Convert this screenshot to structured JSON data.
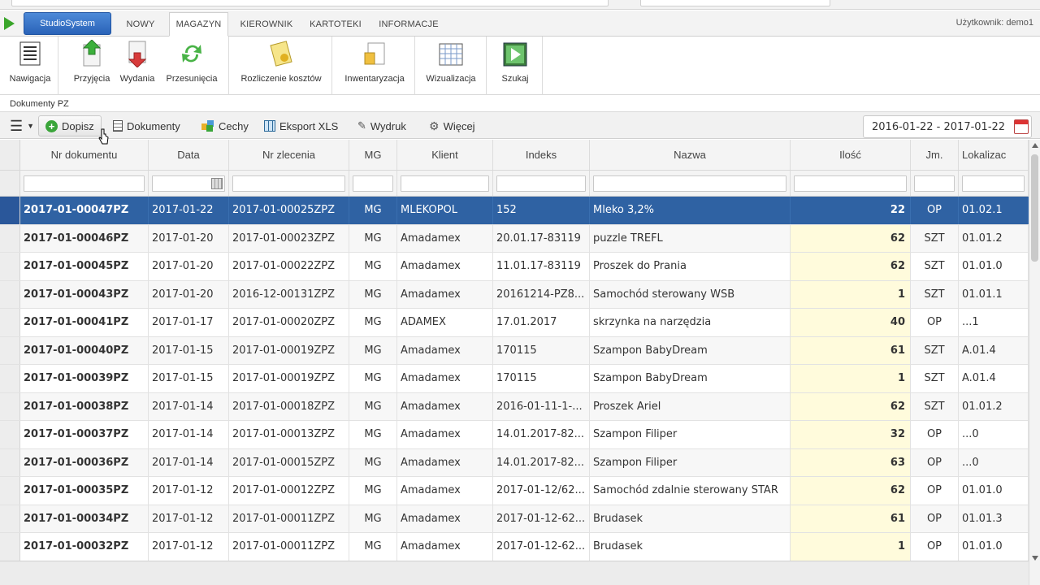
{
  "navbar": {
    "brand": "StudioSystem",
    "tabs": [
      {
        "label": "NOWY",
        "active": false
      },
      {
        "label": "MAGAZYN",
        "active": true
      },
      {
        "label": "KIEROWNIK",
        "active": false
      },
      {
        "label": "KARTOTEKI",
        "active": false
      },
      {
        "label": "INFORMACJE",
        "active": false
      }
    ],
    "user": "Użytkownik: demo1"
  },
  "ribbon": {
    "buttons": [
      {
        "label": "Nawigacja",
        "icon": "navigation-icon"
      },
      {
        "label": "Przyjęcia",
        "icon": "receipt-icon"
      },
      {
        "label": "Wydania",
        "icon": "issue-icon"
      },
      {
        "label": "Przesunięcia",
        "icon": "transfer-icon"
      },
      {
        "label": "Rozliczenie kosztów",
        "icon": "costs-icon"
      },
      {
        "label": "Inwentaryzacja",
        "icon": "inventory-icon"
      },
      {
        "label": "Wizualizacja",
        "icon": "visualization-icon"
      },
      {
        "label": "Szukaj",
        "icon": "search-icon"
      }
    ]
  },
  "section_title": "Dokumenty PZ",
  "toolbar": {
    "add": "Dopisz",
    "documents": "Dokumenty",
    "features": "Cechy",
    "export": "Eksport XLS",
    "print": "Wydruk",
    "more": "Więcej",
    "date_range": "2016-01-22 - 2017-01-22"
  },
  "table": {
    "columns": [
      "Nr dokumentu",
      "Data",
      "Nr zlecenia",
      "MG",
      "Klient",
      "Indeks",
      "Nazwa",
      "Ilość",
      "Jm.",
      "Lokalizac"
    ],
    "rows": [
      [
        "2017-01-00047PZ",
        "2017-01-22",
        "2017-01-00025ZPZ",
        "MG",
        "MLEKOPOL",
        "152",
        "Mleko 3,2%",
        "22",
        "OP",
        "01.02.1"
      ],
      [
        "2017-01-00046PZ",
        "2017-01-20",
        "2017-01-00023ZPZ",
        "MG",
        "Amadamex",
        "20.01.17-83119",
        "puzzle TREFL",
        "62",
        "SZT",
        "01.01.2"
      ],
      [
        "2017-01-00045PZ",
        "2017-01-20",
        "2017-01-00022ZPZ",
        "MG",
        "Amadamex",
        "11.01.17-83119",
        "Proszek do Prania",
        "62",
        "SZT",
        "01.01.0"
      ],
      [
        "2017-01-00043PZ",
        "2017-01-20",
        "2016-12-00131ZPZ",
        "MG",
        "Amadamex",
        "20161214-PZ8...",
        "Samochód sterowany WSB",
        "1",
        "SZT",
        "01.01.1"
      ],
      [
        "2017-01-00041PZ",
        "2017-01-17",
        "2017-01-00020ZPZ",
        "MG",
        "ADAMEX",
        "17.01.2017",
        "skrzynka na narzędzia",
        "40",
        "OP",
        "...1"
      ],
      [
        "2017-01-00040PZ",
        "2017-01-15",
        "2017-01-00019ZPZ",
        "MG",
        "Amadamex",
        "170115",
        "Szampon BabyDream",
        "61",
        "SZT",
        "A.01.4"
      ],
      [
        "2017-01-00039PZ",
        "2017-01-15",
        "2017-01-00019ZPZ",
        "MG",
        "Amadamex",
        "170115",
        "Szampon BabyDream",
        "1",
        "SZT",
        "A.01.4"
      ],
      [
        "2017-01-00038PZ",
        "2017-01-14",
        "2017-01-00018ZPZ",
        "MG",
        "Amadamex",
        "2016-01-11-1-...",
        "Proszek Ariel",
        "62",
        "SZT",
        "01.01.2"
      ],
      [
        "2017-01-00037PZ",
        "2017-01-14",
        "2017-01-00013ZPZ",
        "MG",
        "Amadamex",
        "14.01.2017-82...",
        "Szampon Filiper",
        "32",
        "OP",
        "...0"
      ],
      [
        "2017-01-00036PZ",
        "2017-01-14",
        "2017-01-00015ZPZ",
        "MG",
        "Amadamex",
        "14.01.2017-82...",
        "Szampon Filiper",
        "63",
        "OP",
        "...0"
      ],
      [
        "2017-01-00035PZ",
        "2017-01-12",
        "2017-01-00012ZPZ",
        "MG",
        "Amadamex",
        "2017-01-12/62...",
        "Samochód zdalnie sterowany STAR",
        "62",
        "OP",
        "01.01.0"
      ],
      [
        "2017-01-00034PZ",
        "2017-01-12",
        "2017-01-00011ZPZ",
        "MG",
        "Amadamex",
        "2017-01-12-62...",
        "Brudasek",
        "61",
        "OP",
        "01.01.3"
      ],
      [
        "2017-01-00032PZ",
        "2017-01-12",
        "2017-01-00011ZPZ",
        "MG",
        "Amadamex",
        "2017-01-12-62...",
        "Brudasek",
        "1",
        "OP",
        "01.01.0"
      ]
    ],
    "selected_row": 0
  },
  "colors": {
    "selected": "#2f62a3",
    "brand": "#2a63b8",
    "qty_highlight": "#fffbdc"
  }
}
